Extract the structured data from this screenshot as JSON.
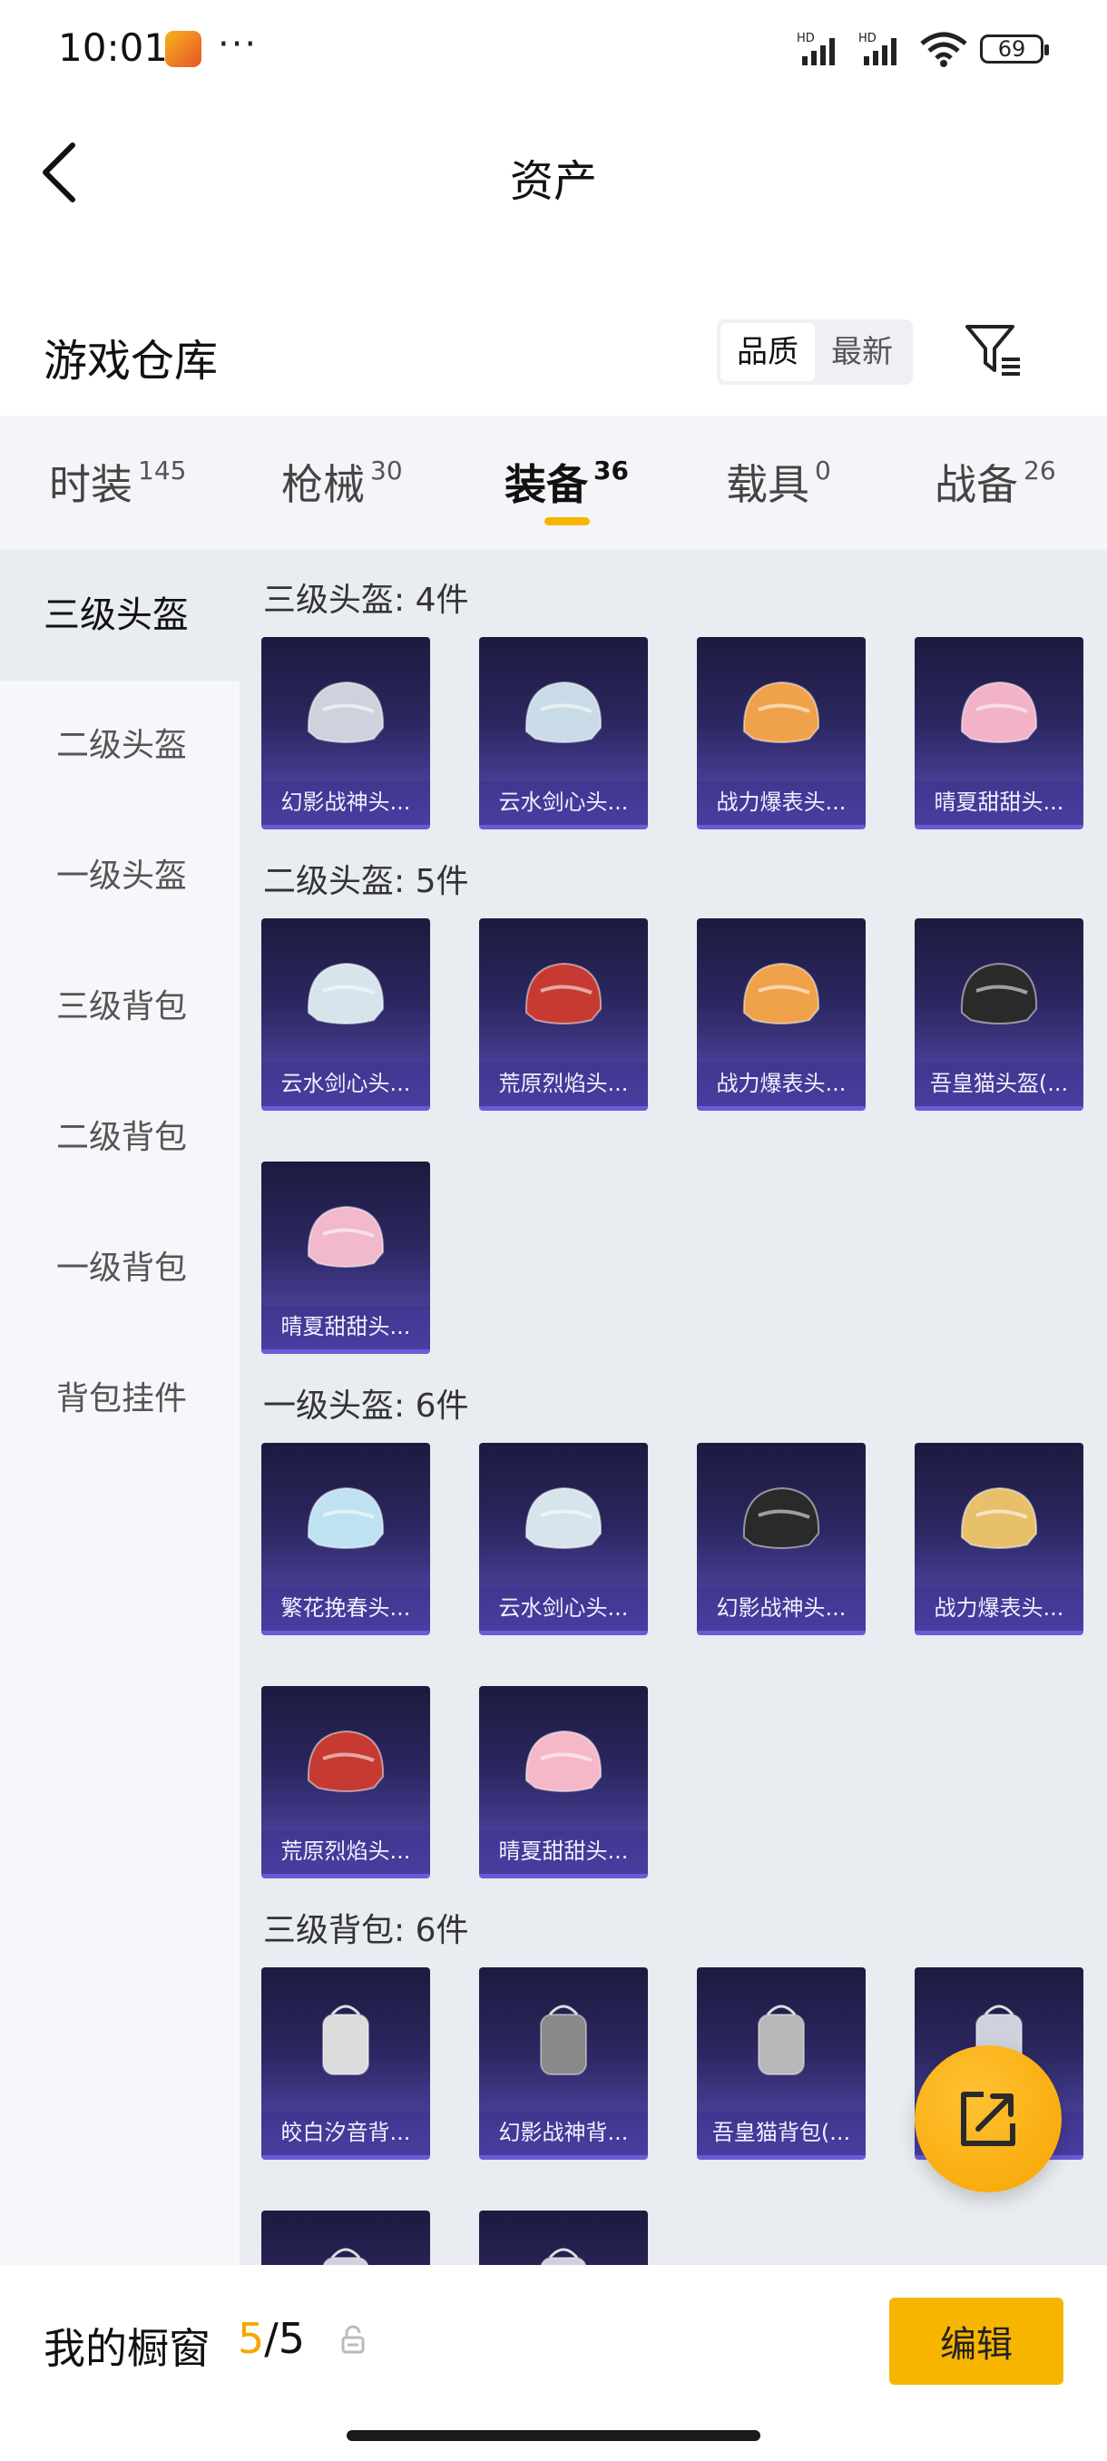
{
  "status": {
    "time": "10:01",
    "more": "···",
    "battery": "69",
    "hd1": "HD",
    "hd2": "HD"
  },
  "header": {
    "title": "资产"
  },
  "warehouse": {
    "title": "游戏仓库",
    "sort": [
      "品质",
      "最新"
    ]
  },
  "tabs": [
    {
      "label": "时装",
      "count": "145"
    },
    {
      "label": "枪械",
      "count": "30"
    },
    {
      "label": "装备",
      "count": "36"
    },
    {
      "label": "载具",
      "count": "0"
    },
    {
      "label": "战备",
      "count": "26"
    }
  ],
  "sidebar": [
    "三级头盔",
    "二级头盔",
    "一级头盔",
    "三级背包",
    "二级背包",
    "一级背包",
    "背包挂件"
  ],
  "sections": [
    {
      "title": "三级头盔: 4件",
      "items": [
        "幻影战神头...",
        "云水剑心头...",
        "战力爆表头...",
        "晴夏甜甜头..."
      ]
    },
    {
      "title": "二级头盔: 5件",
      "items": [
        "云水剑心头...",
        "荒原烈焰头...",
        "战力爆表头...",
        "吾皇猫头盔(...",
        "晴夏甜甜头..."
      ]
    },
    {
      "title": "一级头盔: 6件",
      "items": [
        "繁花挽春头...",
        "云水剑心头...",
        "幻影战神头...",
        "战力爆表头...",
        "荒原烈焰头...",
        "晴夏甜甜头..."
      ]
    },
    {
      "title": "三级背包: 6件",
      "items": [
        "皎白汐音背...",
        "幻影战神背...",
        "吾皇猫背包(...",
        "",
        "",
        ""
      ]
    }
  ],
  "bottom": {
    "title": "我的橱窗",
    "current": "5",
    "separator": "/",
    "total": "5",
    "edit_label": "编辑"
  },
  "colors": {
    "accent": "#f7b500",
    "card_top": "#1d1a3f",
    "card_bottom": "#5a4db8"
  }
}
